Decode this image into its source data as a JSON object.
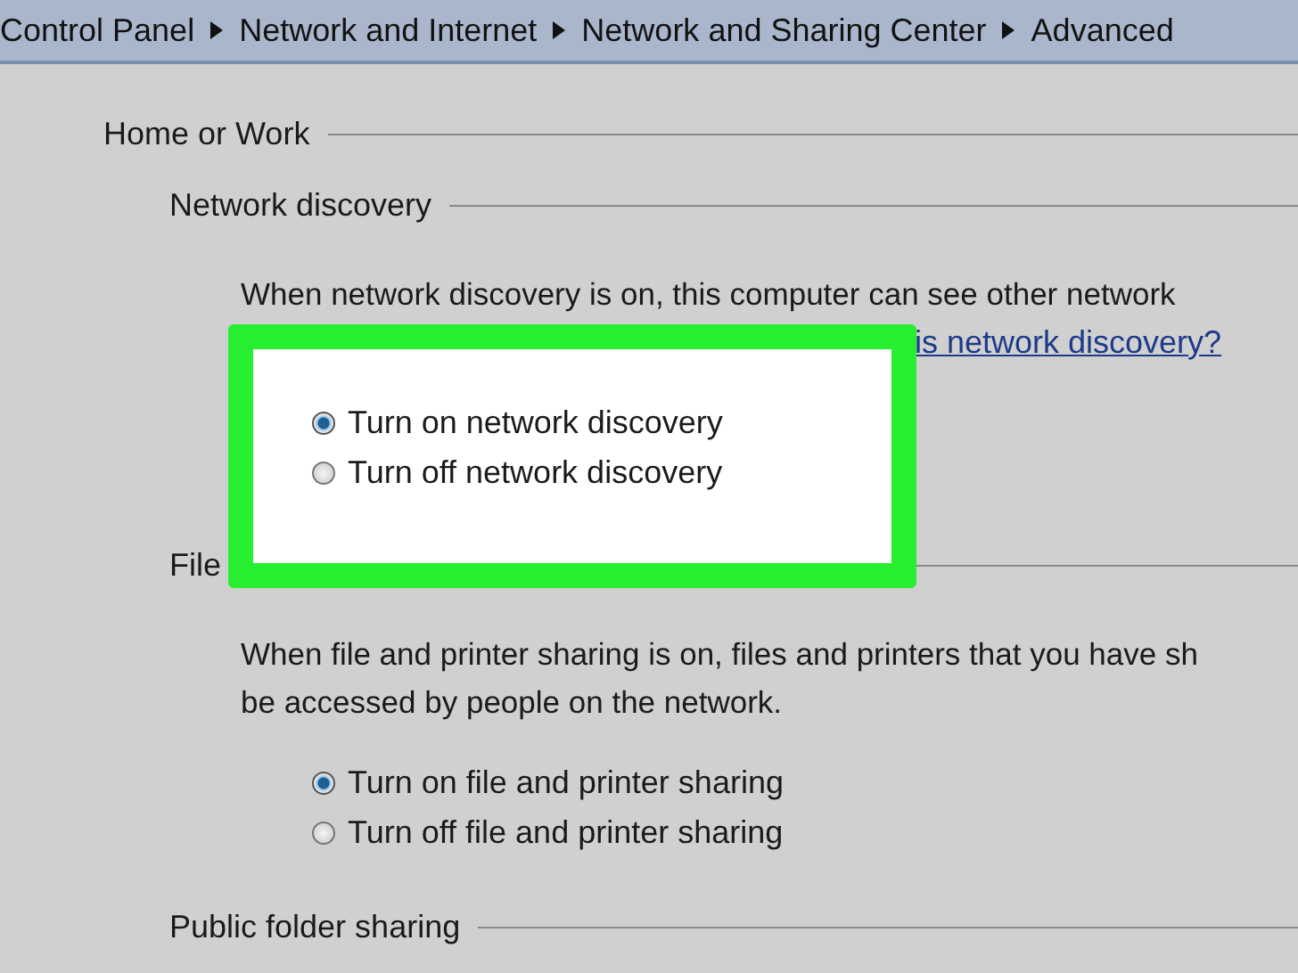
{
  "breadcrumb": [
    {
      "label": "Control Panel"
    },
    {
      "label": "Network and Internet"
    },
    {
      "label": "Network and Sharing Center"
    },
    {
      "label": "Advanced"
    }
  ],
  "section_title": "Home or Work",
  "groups": [
    {
      "title": "Network discovery",
      "highlighted": true,
      "description": [
        "When network discovery is on, this computer can see other network"
      ],
      "link": "is network discovery?",
      "options": [
        {
          "label": "Turn on network discovery",
          "selected": true
        },
        {
          "label": "Turn off network discovery",
          "selected": false
        }
      ]
    },
    {
      "title": "File",
      "highlighted": false,
      "description": [
        "When file and printer sharing is on, files and printers that you have sh",
        "be accessed by people on the network."
      ],
      "options": [
        {
          "label": "Turn on file and printer sharing",
          "selected": true
        },
        {
          "label": "Turn off file and printer sharing",
          "selected": false
        }
      ]
    },
    {
      "title": "Public folder sharing",
      "highlighted": false
    }
  ]
}
